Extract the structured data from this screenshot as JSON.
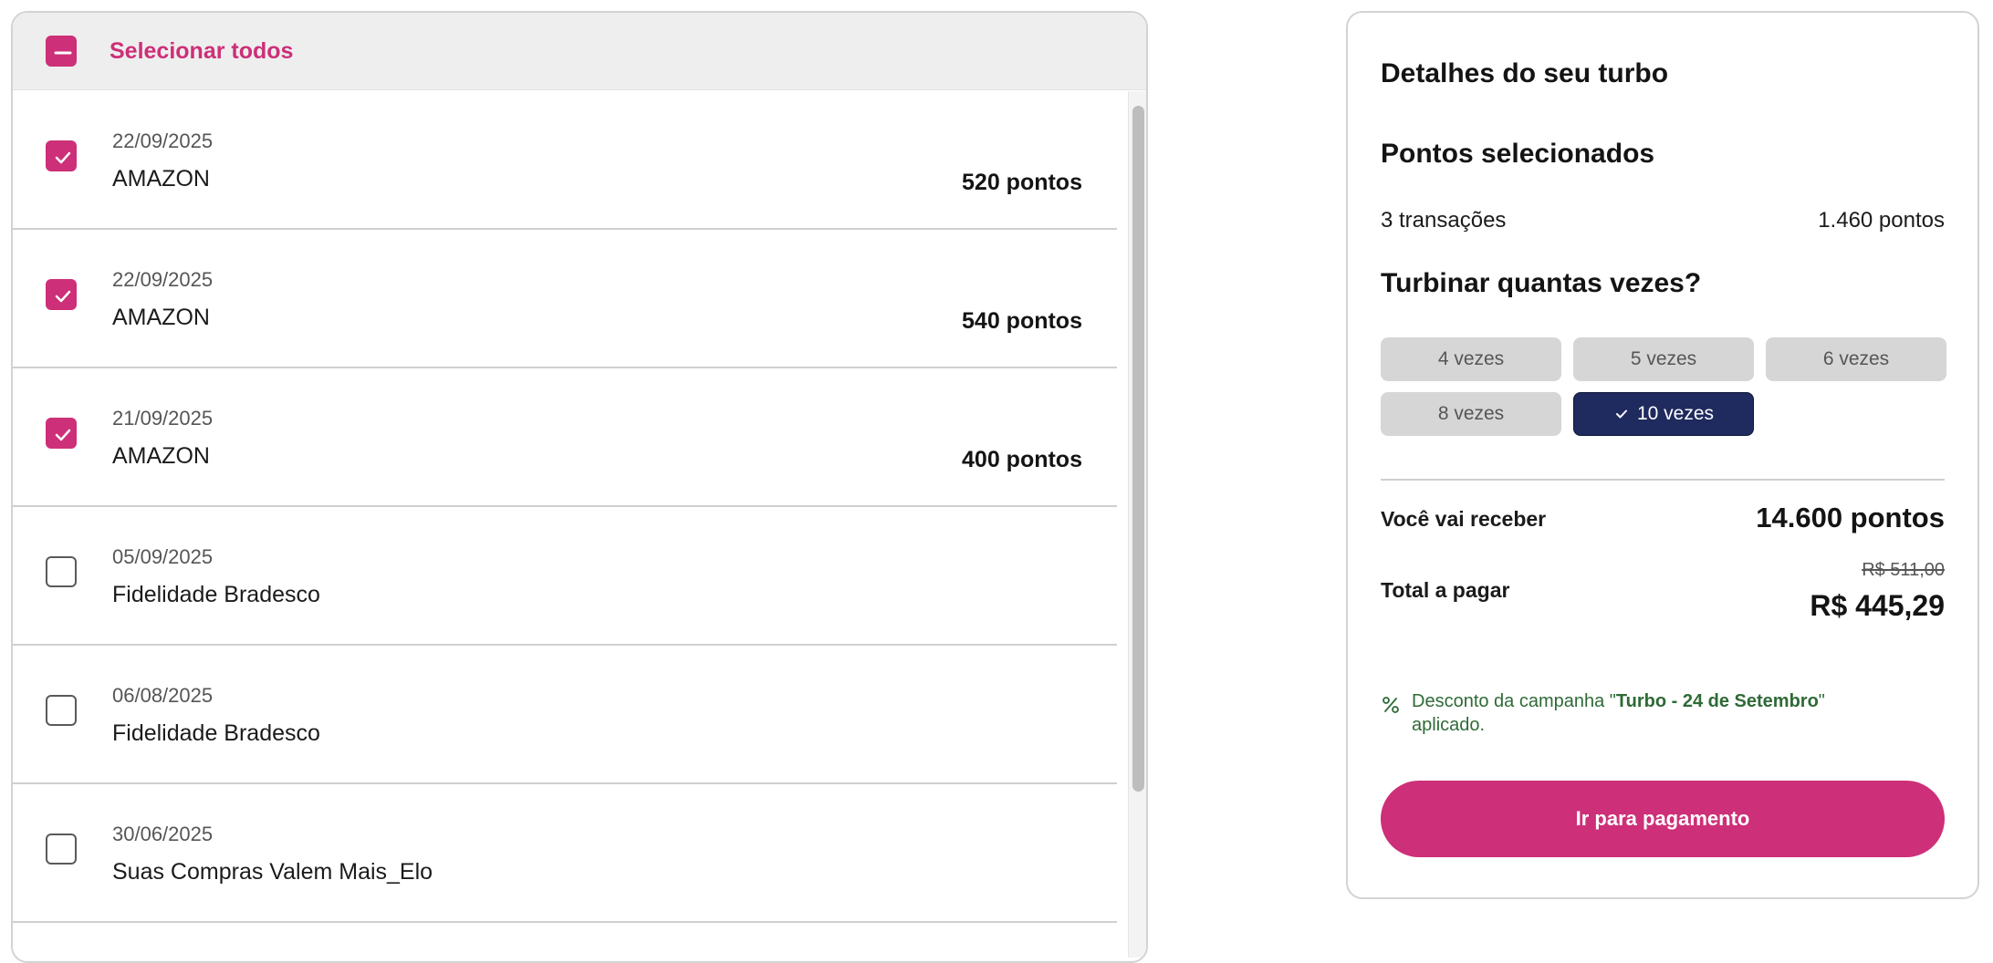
{
  "select_all": {
    "label": "Selecionar todos",
    "state": "indeterminate"
  },
  "transactions": [
    {
      "date": "22/09/2025",
      "merchant": "AMAZON",
      "points": "520 pontos",
      "checked": true
    },
    {
      "date": "22/09/2025",
      "merchant": "AMAZON",
      "points": "540 pontos",
      "checked": true
    },
    {
      "date": "21/09/2025",
      "merchant": "AMAZON",
      "points": "400 pontos",
      "checked": true
    },
    {
      "date": "05/09/2025",
      "merchant": "Fidelidade Bradesco",
      "points": "",
      "checked": false
    },
    {
      "date": "06/08/2025",
      "merchant": "Fidelidade Bradesco",
      "points": "",
      "checked": false
    },
    {
      "date": "30/06/2025",
      "merchant": "Suas Compras Valem Mais_Elo",
      "points": "",
      "checked": false
    }
  ],
  "summary": {
    "title": "Detalhes do seu turbo",
    "selected_heading": "Pontos selecionados",
    "transactions_count": "3 transações",
    "transactions_points": "1.460 pontos",
    "multiplier_heading": "Turbinar quantas vezes?",
    "multipliers": [
      {
        "label": "4 vezes",
        "selected": false
      },
      {
        "label": "5 vezes",
        "selected": false
      },
      {
        "label": "6 vezes",
        "selected": false
      },
      {
        "label": "8 vezes",
        "selected": false
      },
      {
        "label": "10 vezes",
        "selected": true
      }
    ],
    "receive_label": "Você vai receber",
    "receive_value": "14.600 pontos",
    "total_label": "Total a pagar",
    "old_price": "R$ 511,00",
    "new_price": "R$ 445,29",
    "discount_prefix": "Desconto da campanha \"",
    "discount_campaign": "Turbo - 24 de Setembro",
    "discount_suffix": "\" aplicado.",
    "pay_button": "Ir para pagamento"
  },
  "colors": {
    "brand_pink": "#cd2f78",
    "selected_navy": "#1f2a5e",
    "discount_green": "#2f6a37"
  },
  "icons": {
    "checkbox_checked": "check-icon",
    "checkbox_indeterminate": "minus-icon",
    "chip_selected": "check-icon",
    "discount": "percent-icon"
  }
}
